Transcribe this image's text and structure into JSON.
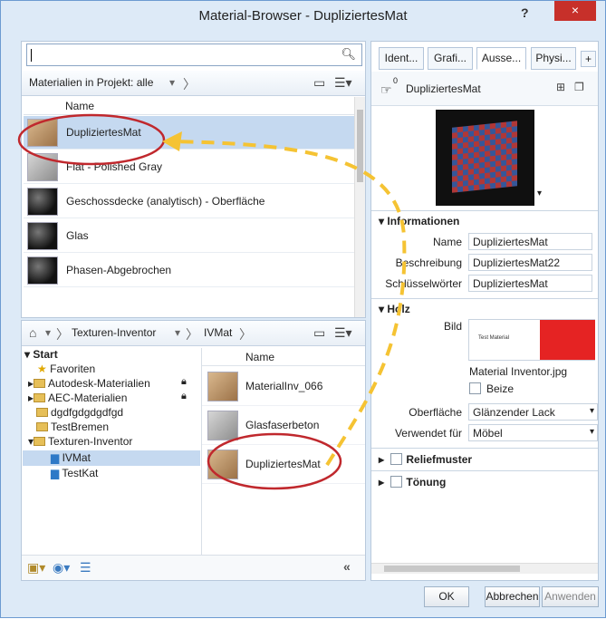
{
  "window": {
    "title": "Material-Browser - DupliziertesMat",
    "help": "?",
    "close": "×"
  },
  "search": {
    "placeholder": ""
  },
  "project_bar": {
    "label": "Materialien in Projekt: alle",
    "column_header": "Name"
  },
  "project_materials": [
    {
      "name": "DupliziertesMat",
      "thumb": "wood",
      "selected": true
    },
    {
      "name": "Flat - Polished Gray",
      "thumb": "gray"
    },
    {
      "name": "Geschossdecke (analytisch) - Oberfläche",
      "thumb": "dark"
    },
    {
      "name": "Glas",
      "thumb": "dark"
    },
    {
      "name": "Phasen-Abgebrochen",
      "thumb": "dark"
    }
  ],
  "library_bar": {
    "crumb1": "Texturen-Inventor",
    "crumb2": "IVMat"
  },
  "tree": {
    "start": "Start",
    "favoriten": "Favoriten",
    "autodesk": "Autodesk-Materialien",
    "aec": "AEC-Materialien",
    "dgd": "dgdfgdgdgdfgd",
    "bremen": "TestBremen",
    "texturen": "Texturen-Inventor",
    "ivmat": "IVMat",
    "testkat": "TestKat"
  },
  "library": {
    "column_header": "Name",
    "items": [
      {
        "name": "MaterialInv_066",
        "thumb": "wood"
      },
      {
        "name": "Glasfaserbeton",
        "thumb": "gray"
      },
      {
        "name": "DupliziertesMat",
        "thumb": "wood"
      }
    ]
  },
  "editor": {
    "tabs": [
      "Ident...",
      "Grafi...",
      "Ausse...",
      "Physi...",
      "+"
    ],
    "material_name": "DupliziertesMat",
    "count": "0",
    "info_section": "Informationen",
    "fields": {
      "name_label": "Name",
      "name_value": "DupliziertesMat",
      "desc_label": "Beschreibung",
      "desc_value": "DupliziertesMat22",
      "keywords_label": "Schlüsselwörter",
      "keywords_value": "DupliziertesMat"
    },
    "holz_section": "Holz",
    "bild_label": "Bild",
    "bild_preview_text": "Test Material",
    "bild_file": "Material Inventor.jpg",
    "beize_label": "Beize",
    "oberflaeche_label": "Oberfläche",
    "oberflaeche_value": "Glänzender Lack",
    "verwendet_label": "Verwendet für",
    "verwendet_value": "Möbel",
    "relief": "Reliefmuster",
    "toenung": "Tönung"
  },
  "buttons": {
    "ok": "OK",
    "cancel": "Abbrechen",
    "apply": "Anwenden"
  },
  "colors": {
    "highlight": "#c5d9f0",
    "annotation": "#f5c333",
    "circle": "#c0282d"
  }
}
